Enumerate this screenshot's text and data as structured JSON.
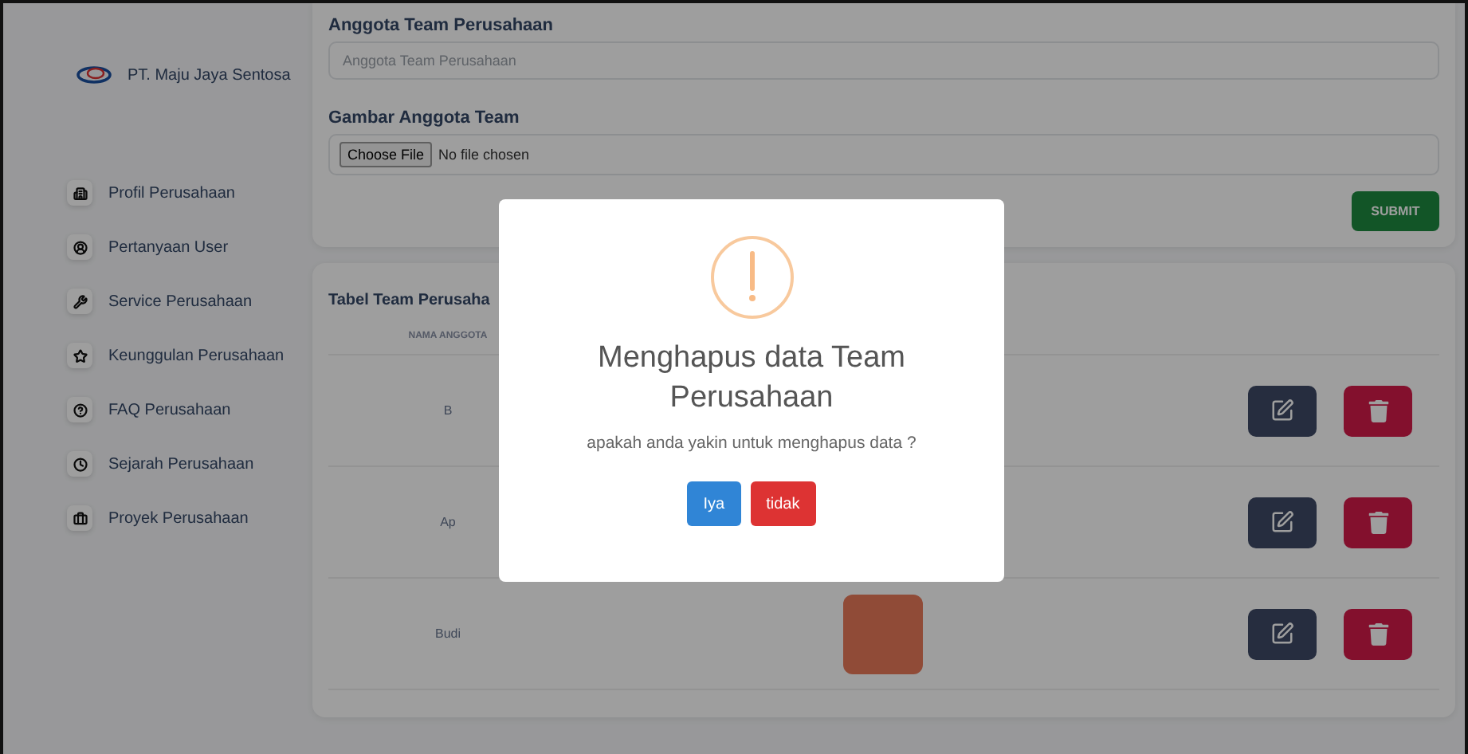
{
  "sidebar": {
    "brand": "PT. Maju Jaya Sentosa",
    "items": [
      {
        "label": "Profil Perusahaan"
      },
      {
        "label": "Pertanyaan User"
      },
      {
        "label": "Service Perusahaan"
      },
      {
        "label": "Keunggulan Perusahaan"
      },
      {
        "label": "FAQ Perusahaan"
      },
      {
        "label": "Sejarah Perusahaan"
      },
      {
        "label": "Proyek Perusahaan"
      }
    ]
  },
  "form": {
    "fields": [
      {
        "kind": "text",
        "label": "Anggota Team Perusahaan",
        "placeholder": "Anggota Team Perusahaan"
      },
      {
        "kind": "file",
        "label": "Gambar Anggota Team",
        "button": "Choose File",
        "value": "No file chosen"
      }
    ],
    "submit": "SUBMIT"
  },
  "table": {
    "title": "Tabel Team Perusaha",
    "columns": [
      "NAMA ANGGOTA"
    ],
    "rows": [
      {
        "name": "B"
      },
      {
        "name": "Ap"
      },
      {
        "name": "Budi"
      }
    ]
  },
  "dialog": {
    "title": "Menghapus data Team Perusahaan",
    "message": "apakah anda yakin untuk menghapus data ?",
    "buttons": [
      {
        "label": "Iya",
        "kind": "confirm"
      },
      {
        "label": "tidak",
        "kind": "cancel"
      }
    ]
  }
}
